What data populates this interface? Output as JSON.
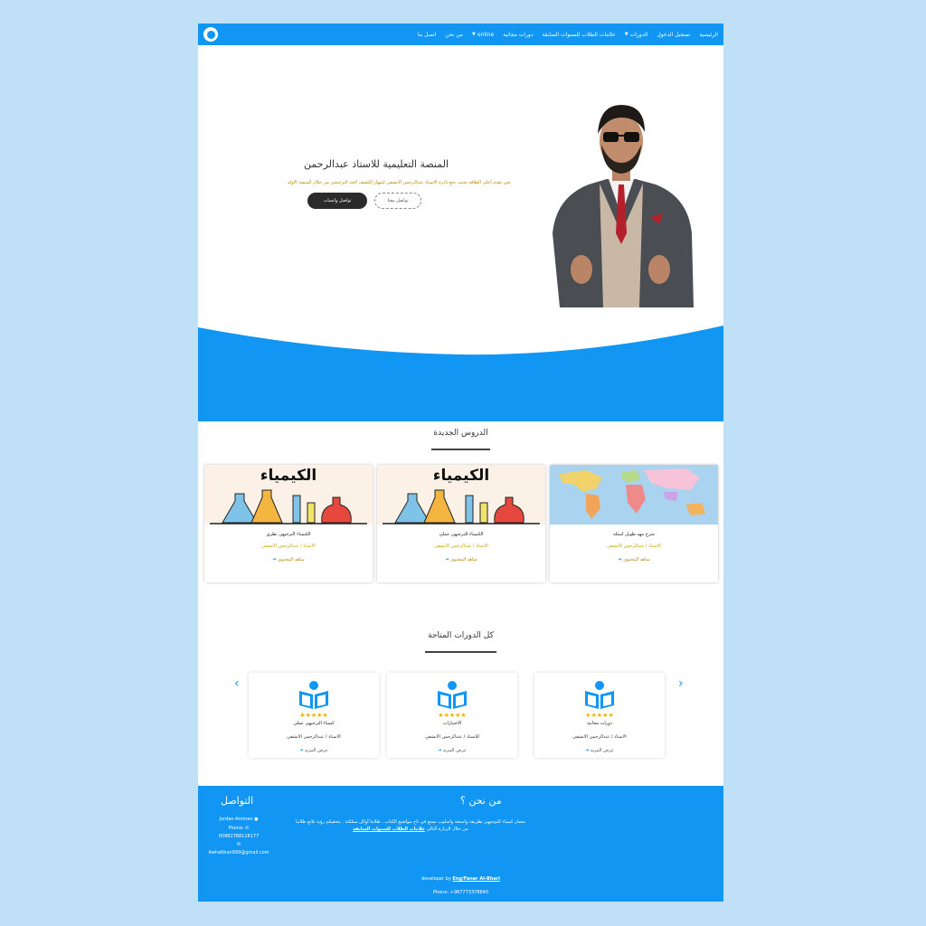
{
  "nav": {
    "items": [
      "الرئيسية",
      "تسجيل الدخول",
      "الدورات",
      "علامات الطلاب للسنوات السابقة",
      "دورات مجانية",
      "online",
      "من نحن",
      "اتصل بنا"
    ]
  },
  "hero": {
    "title": "المنصة التعليمية للاستاذ عبدالرحمن",
    "subtitle": "نحن نقدم أعلى الطاقة يحتب نخع بادرة الاستاذ عبدالرحمن الانشقي لنمهار الكشف الحد الترجيحي من خلال المنصة الاولد",
    "whatsapp_button": "تواصل واتساب",
    "contact_button": "تواصل معنا"
  },
  "lessons": {
    "title": "الدروس الجديدة",
    "cards": [
      {
        "title": "شرح مهد طويل اسئلة",
        "author": "الاستاذ / عبدالرحمن الانشقي",
        "more": "شاهد المحتوى",
        "thumb": "map"
      },
      {
        "title": "الكيمياء للترجيهي عملي",
        "author": "الاستاذ / عبدالرحمن الانشقي",
        "more": "شاهد المحتوى",
        "thumb": "chem"
      },
      {
        "title": "الكيمياء الترجيهي نظري",
        "author": "الاستاذ / عبدالرحمن الانشقي",
        "more": "شاهد المحتوى",
        "thumb": "chem"
      }
    ],
    "chem_word": "الكيمياء"
  },
  "courses": {
    "title": "كل الدورات المتاحة",
    "cards": [
      {
        "name": "دورات مجانية",
        "teacher": "الاستاذ / عبدالرحمن الانشقي",
        "more": "عرض المزيد",
        "stars": "★★★★★"
      },
      {
        "name": "الاختبارات",
        "teacher": "للاستاذ / عبدالرحمن الانشقي",
        "more": "عرض المزيد",
        "stars": "★★★★★"
      },
      {
        "name": "كيمياء الترجيهي عملي",
        "teacher": "الاستاذ / عبدالرحمن الانشقي",
        "more": "عرض المزيد",
        "stars": "★★★★★"
      }
    ]
  },
  "footer": {
    "about_title": "من نحن ؟",
    "about_text": "معمار كيمياء للتوجيهي بطريقة واستعة واسلوب ممتع في تاج مواضيع الكتاب . طلابنا أوائل مملكتة . بتحقيكم رؤية تلاتع طلابنا من خلال الزيارة التالي",
    "about_link": "علامات الطلاب للسنوات السابقة",
    "contact_title": "التواصل",
    "location": "Jordan-Amman",
    "phone_label": "Phone:",
    "phone": "00962788116177",
    "email": "Awhatbian999@gmail.com",
    "developer_label": "developer by",
    "developer_name": "Eng/Fanar Al-Bhari",
    "dev_phone": "Phone: +967773378840"
  },
  "colors": {
    "brand": "#1196f3",
    "star": "#f1b300"
  },
  "icons": [
    "logo-icon",
    "location-icon",
    "phone-icon",
    "email-icon",
    "chevron-left-icon",
    "chevron-right-icon",
    "book-reader-icon"
  ]
}
